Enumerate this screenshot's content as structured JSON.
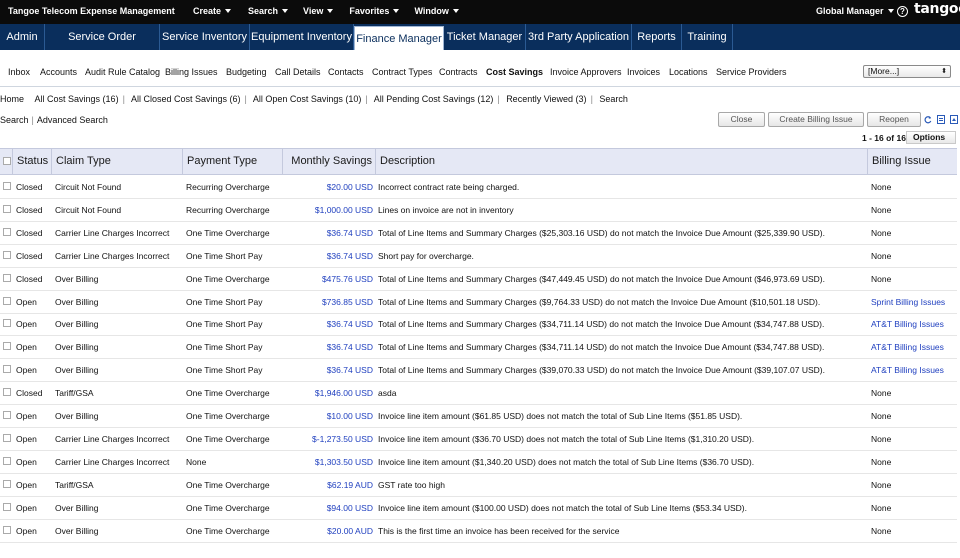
{
  "topbar": {
    "title": "Tangoe Telecom Expense Management",
    "menus": [
      "Create",
      "Search",
      "View",
      "Favorites",
      "Window"
    ],
    "user_role": "Global Manager",
    "help": "?",
    "logo": "tangoe"
  },
  "modules": [
    {
      "label": "Admin"
    },
    {
      "label": "Service Order Manager"
    },
    {
      "label": "Service Inventory"
    },
    {
      "label": "Equipment Inventory"
    },
    {
      "label": "Finance Manager",
      "active": true
    },
    {
      "label": "Ticket Manager"
    },
    {
      "label": "3rd Party Application"
    },
    {
      "label": "Reports"
    },
    {
      "label": "Training"
    }
  ],
  "subnav": {
    "items": [
      "Inbox",
      "Accounts",
      "Audit Rule Catalog",
      "Billing Issues",
      "Budgeting",
      "Call Details",
      "Contacts",
      "Contract Types",
      "Contracts",
      "Cost Savings",
      "Invoice Approvers",
      "Invoices",
      "Locations",
      "Service Providers"
    ],
    "active": "Cost Savings",
    "more": "[More...]"
  },
  "filters": [
    "Home",
    "All Cost Savings (16)",
    "All Closed Cost Savings (6)",
    "All Open Cost Savings (10)",
    "All Pending Cost Savings (12)",
    "Recently Viewed (3)",
    "Search"
  ],
  "search_links": [
    "Search",
    "Advanced Search"
  ],
  "buttons": {
    "close": "Close",
    "create_billing_issue": "Create Billing Issue",
    "reopen": "Reopen"
  },
  "pager": "1 - 16 of 16",
  "options_label": "Options",
  "columns": [
    "Status",
    "Claim Type",
    "Payment Type",
    "Monthly Savings",
    "Description",
    "Billing Issue"
  ],
  "rows": [
    {
      "status": "Closed",
      "claim": "Circuit Not Found",
      "payment": "Recurring Overcharge",
      "savings": "$20.00 USD",
      "desc": "Incorrect contract rate being charged.",
      "issue": "None"
    },
    {
      "status": "Closed",
      "claim": "Circuit Not Found",
      "payment": "Recurring Overcharge",
      "savings": "$1,000.00 USD",
      "desc": "Lines on invoice are not in inventory",
      "issue": "None"
    },
    {
      "status": "Closed",
      "claim": "Carrier Line Charges Incorrect",
      "payment": "One Time Overcharge",
      "savings": "$36.74 USD",
      "desc": "Total of Line Items and Summary Charges ($25,303.16 USD) do not match the Invoice Due Amount ($25,339.90 USD).",
      "issue": "None"
    },
    {
      "status": "Closed",
      "claim": "Carrier Line Charges Incorrect",
      "payment": "One Time Short Pay",
      "savings": "$36.74 USD",
      "desc": "Short pay for overcharge.",
      "issue": "None"
    },
    {
      "status": "Closed",
      "claim": "Over Billing",
      "payment": "One Time Overcharge",
      "savings": "$475.76 USD",
      "desc": "Total of Line Items and Summary Charges ($47,449.45 USD) do not match the Invoice Due Amount ($46,973.69 USD).",
      "issue": "None"
    },
    {
      "status": "Open",
      "claim": "Over Billing",
      "payment": "One Time Short Pay",
      "savings": "$736.85 USD",
      "desc": "Total of Line Items and Summary Charges ($9,764.33 USD) do not match the Invoice Due Amount ($10,501.18 USD).",
      "issue": "Sprint Billing Issues"
    },
    {
      "status": "Open",
      "claim": "Over Billing",
      "payment": "One Time Short Pay",
      "savings": "$36.74 USD",
      "desc": "Total of Line Items and Summary Charges ($34,711.14 USD) do not match the Invoice Due Amount ($34,747.88 USD).",
      "issue": "AT&T Billing Issues"
    },
    {
      "status": "Open",
      "claim": "Over Billing",
      "payment": "One Time Short Pay",
      "savings": "$36.74 USD",
      "desc": "Total of Line Items and Summary Charges ($34,711.14 USD) do not match the Invoice Due Amount ($34,747.88 USD).",
      "issue": "AT&T Billing Issues"
    },
    {
      "status": "Open",
      "claim": "Over Billing",
      "payment": "One Time Short Pay",
      "savings": "$36.74 USD",
      "desc": "Total of Line Items and Summary Charges ($39,070.33 USD) do not match the Invoice Due Amount ($39,107.07 USD).",
      "issue": "AT&T Billing Issues"
    },
    {
      "status": "Closed",
      "claim": "Tariff/GSA",
      "payment": "One Time Overcharge",
      "savings": "$1,946.00 USD",
      "desc": "asda",
      "issue": "None"
    },
    {
      "status": "Open",
      "claim": "Over Billing",
      "payment": "One Time Overcharge",
      "savings": "$10.00 USD",
      "desc": "Invoice line item amount ($61.85 USD) does not match the total of Sub Line Items ($51.85 USD).",
      "issue": "None"
    },
    {
      "status": "Open",
      "claim": "Carrier Line Charges Incorrect",
      "payment": "One Time Overcharge",
      "savings": "$-1,273.50 USD",
      "desc": "Invoice line item amount ($36.70 USD) does not match the total of Sub Line Items ($1,310.20 USD).",
      "issue": "None"
    },
    {
      "status": "Open",
      "claim": "Carrier Line Charges Incorrect",
      "payment": "None",
      "savings": "$1,303.50 USD",
      "desc": "Invoice line item amount ($1,340.20 USD) does not match the total of Sub Line Items ($36.70 USD).",
      "issue": "None"
    },
    {
      "status": "Open",
      "claim": "Tariff/GSA",
      "payment": "One Time Overcharge",
      "savings": "$62.19 AUD",
      "desc": "GST rate too high",
      "issue": "None"
    },
    {
      "status": "Open",
      "claim": "Over Billing",
      "payment": "One Time Overcharge",
      "savings": "$94.00 USD",
      "desc": "Invoice line item amount ($100.00 USD) does not match the total of Sub Line Items ($53.34 USD).",
      "issue": "None"
    },
    {
      "status": "Open",
      "claim": "Over Billing",
      "payment": "One Time Overcharge",
      "savings": "$20.00 AUD",
      "desc": "This is the first time an invoice has been received for the service",
      "issue": "None"
    }
  ]
}
